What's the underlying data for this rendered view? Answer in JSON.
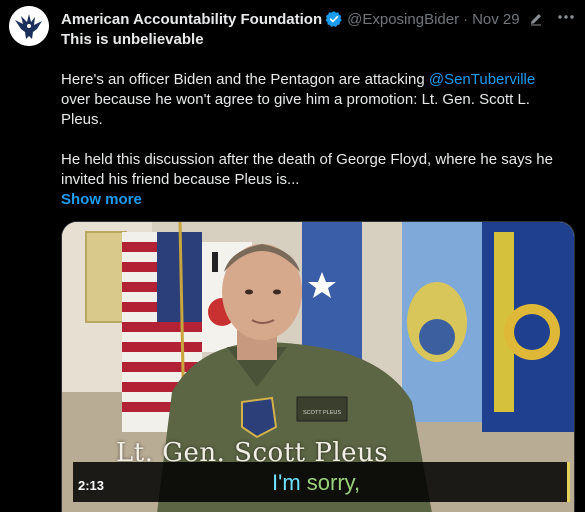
{
  "author": {
    "name": "American Accountability Foundation",
    "handle": "@ExposingBider",
    "separator": "·",
    "date": "Nov 29"
  },
  "tweet": {
    "headline": "This is unbelievable",
    "p1_before": "Here's an officer Biden and the Pentagon are attacking ",
    "p1_mention": "@SenTuberville",
    "p1_line2": "over because he won't agree to give him a promotion: Lt. Gen. Scott L.",
    "p1_line3": "Pleus.",
    "p2_line1": "He held this discussion after the death of George Floyd, where he says he",
    "p2_line2": "invited his friend because Pleus is...",
    "show_more": "Show more"
  },
  "media": {
    "name_overlay": "Lt. Gen. Scott Pleus",
    "caption_word1": "I'm",
    "caption_word2": "sorry,",
    "timestamp": "2:13",
    "name_tag": "SCOTT PLEUS"
  },
  "colors": {
    "background": "#000000",
    "text": "#e7e9ea",
    "muted": "#71767b",
    "accent": "#1d9bf0"
  },
  "icons": {
    "avatar": "eagle-logo",
    "verified": "verified-badge-icon",
    "edit": "edited-pencil-icon",
    "more": "more-options-icon"
  }
}
